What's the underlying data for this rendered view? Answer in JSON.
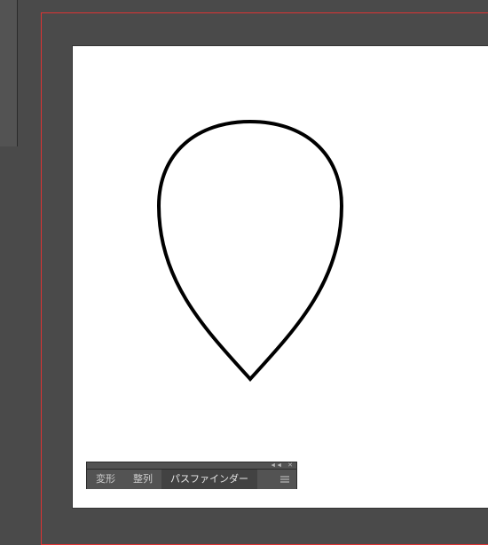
{
  "panel": {
    "tabs": [
      {
        "label": "変形",
        "active": false
      },
      {
        "label": "整列",
        "active": false
      },
      {
        "label": "パスファインダー",
        "active": true
      }
    ]
  },
  "icons": {
    "collapse": "◄◄",
    "close": "✕",
    "menu": "≡"
  }
}
